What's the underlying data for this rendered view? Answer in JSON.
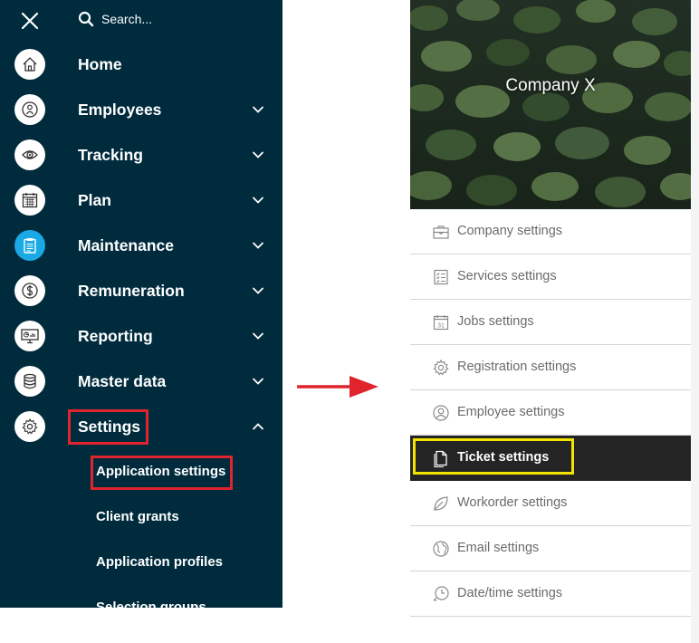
{
  "sidebar": {
    "search_placeholder": "Search...",
    "items": [
      {
        "label": "Home",
        "icon": "home-icon",
        "has_chevron": false
      },
      {
        "label": "Employees",
        "icon": "employee-icon",
        "has_chevron": true
      },
      {
        "label": "Tracking",
        "icon": "eye-icon",
        "has_chevron": true
      },
      {
        "label": "Plan",
        "icon": "calendar-icon",
        "has_chevron": true
      },
      {
        "label": "Maintenance",
        "icon": "clipboard-icon",
        "has_chevron": true,
        "active": true
      },
      {
        "label": "Remuneration",
        "icon": "dollar-coin-icon",
        "has_chevron": true
      },
      {
        "label": "Reporting",
        "icon": "monitor-chart-icon",
        "has_chevron": true
      },
      {
        "label": "Master data",
        "icon": "database-icon",
        "has_chevron": true
      },
      {
        "label": "Settings",
        "icon": "gear-icon",
        "has_chevron": true,
        "expanded": true
      }
    ],
    "settings_sub_items": [
      "Application settings",
      "Client grants",
      "Application profiles",
      "Selection groups"
    ]
  },
  "right_panel": {
    "company_name": "Company X",
    "menu": [
      {
        "label": "Company settings",
        "icon": "briefcase-icon"
      },
      {
        "label": "Services settings",
        "icon": "checklist-icon"
      },
      {
        "label": "Jobs settings",
        "icon": "calendar-31-icon"
      },
      {
        "label": "Registration settings",
        "icon": "gear-icon"
      },
      {
        "label": "Employee settings",
        "icon": "user-icon"
      },
      {
        "label": "Ticket settings",
        "icon": "document-icon",
        "active": true
      },
      {
        "label": "Workorder settings",
        "icon": "leaf-icon"
      },
      {
        "label": "Email settings",
        "icon": "globe-icon"
      },
      {
        "label": "Date/time settings",
        "icon": "clock-icon"
      }
    ]
  },
  "colors": {
    "sidebar_bg": "#002b3d",
    "active_icon_bg": "#1aa9e4",
    "highlight_red": "#e0242d",
    "highlight_yellow": "#f2e400",
    "active_menu_bg": "#242424",
    "arrow": "#e0242d"
  }
}
